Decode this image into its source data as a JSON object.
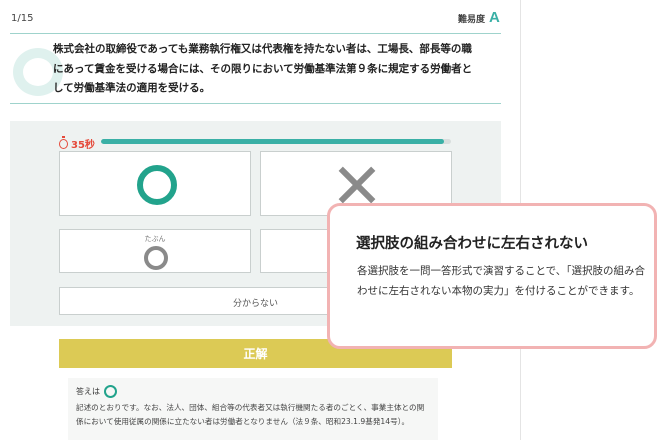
{
  "header": {
    "progress": "1/15",
    "difficulty_label": "難易度",
    "difficulty_value": "A"
  },
  "question": {
    "text": "株式会社の取締役であっても業務執行権又は代表権を持たない者は、工場長、部長等の職にあって賃金を受ける場合には、その限りにおいて労働基準法第９条に規定する労働者として労働基準法の適用を受ける。"
  },
  "timer": {
    "label": "35秒",
    "remaining_fraction": 0.98,
    "color": "#e54a3b",
    "fill_color": "#3ab0a6"
  },
  "choices": {
    "maru_icon": "maru-circle-icon",
    "batsu_icon": "batsu-cross-icon",
    "tabun_label": "たぶん",
    "tabun_icon": "small-maru-circle-icon",
    "unknown_label": "分からない"
  },
  "answer": {
    "header": "正解",
    "prefix": "答えは",
    "explanation": "記述のとおりです。なお、法人、団体、組合等の代表者又は執行機関たる者のごとく、事業主体との関係において使用従属の関係に立たない者は労働者となりません（法９条、昭和23.1.9基発14号）。",
    "header_color": "#dcca55"
  },
  "callout": {
    "title": "選択肢の組み合わせに左右されない",
    "body": "各選択肢を一問一答形式で演習することで、「選択肢の組み合わせに左右されない本物の実力」を付けることができます。",
    "border_color": "#f2b3b3"
  },
  "colors": {
    "accent": "#3ab0a6",
    "correct_green": "#22a38c"
  }
}
